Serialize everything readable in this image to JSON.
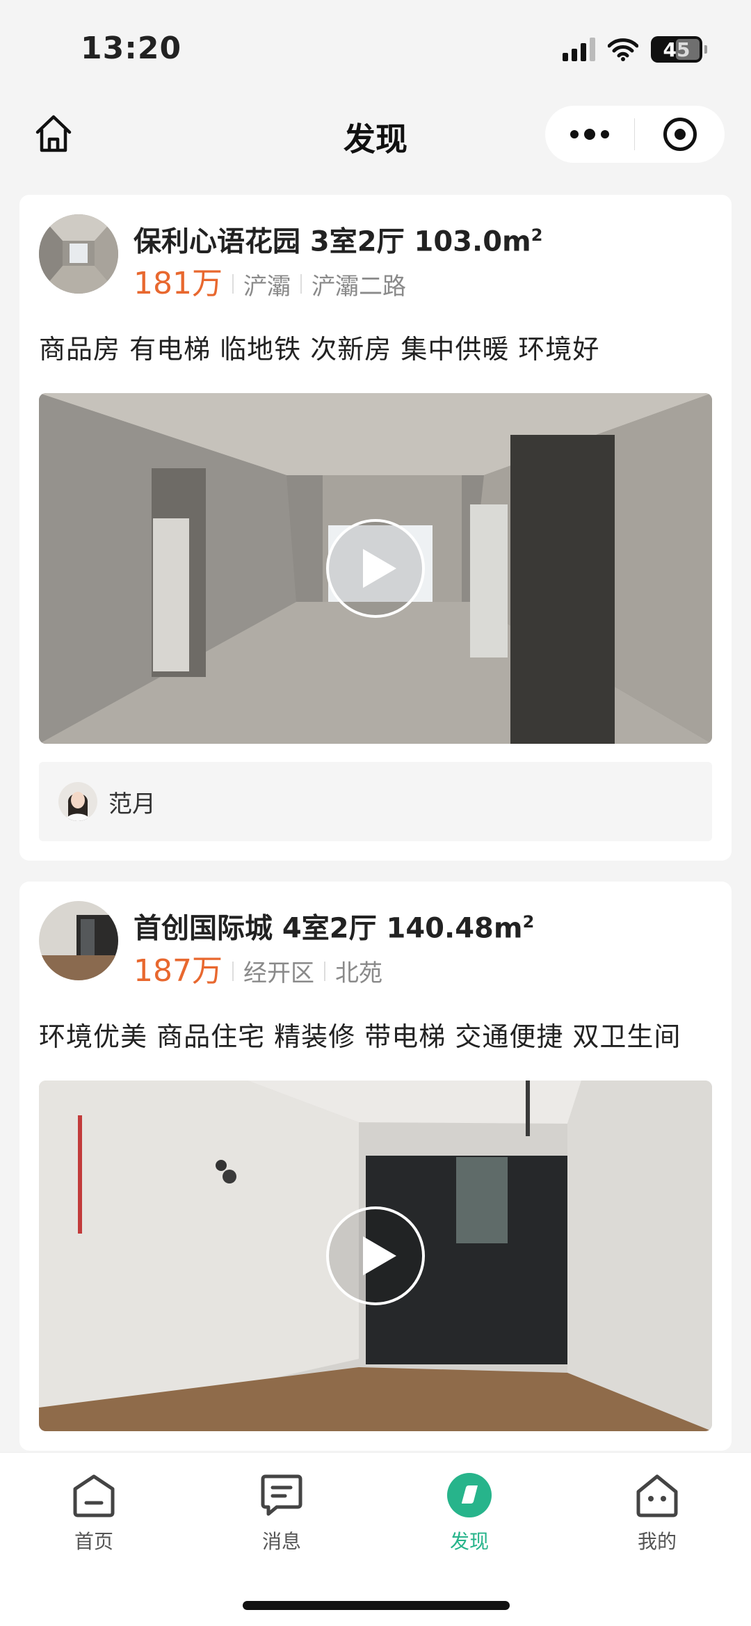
{
  "status_bar": {
    "time": "13:20",
    "battery": "45"
  },
  "nav": {
    "title": "发现"
  },
  "listings": [
    {
      "title": "保利心语花园 3室2厅 103.0m",
      "sup": "2",
      "price": "181万",
      "district": "浐灞",
      "street": "浐灞二路",
      "tags": "商品房 有电梯 临地铁 次新房 集中供暖 环境好",
      "agent": "范月"
    },
    {
      "title": "首创国际城 4室2厅 140.48m",
      "sup": "2",
      "price": "187万",
      "district": "经开区",
      "street": "北苑",
      "tags": "环境优美 商品住宅 精装修 带电梯 交通便捷 双卫生间"
    }
  ],
  "tabbar": [
    {
      "label": "首页",
      "icon": "home-tab-icon"
    },
    {
      "label": "消息",
      "icon": "message-icon"
    },
    {
      "label": "发现",
      "icon": "discover-icon",
      "active": true
    },
    {
      "label": "我的",
      "icon": "profile-icon"
    }
  ],
  "colors": {
    "price": "#e8682f",
    "accent": "#27b48b"
  }
}
